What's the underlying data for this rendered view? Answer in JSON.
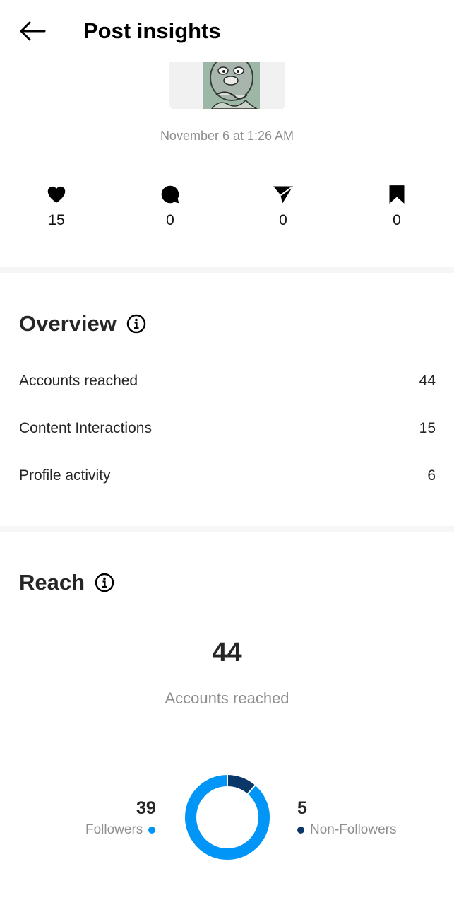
{
  "header": {
    "title": "Post insights"
  },
  "post": {
    "date": "November 6 at 1:26 AM"
  },
  "stats": [
    {
      "icon": "heart-icon",
      "value": "15"
    },
    {
      "icon": "comment-icon",
      "value": "0"
    },
    {
      "icon": "share-icon",
      "value": "0"
    },
    {
      "icon": "bookmark-icon",
      "value": "0"
    }
  ],
  "overview": {
    "title": "Overview",
    "rows": [
      {
        "label": "Accounts reached",
        "value": "44"
      },
      {
        "label": "Content Interactions",
        "value": "15"
      },
      {
        "label": "Profile activity",
        "value": "6"
      }
    ]
  },
  "reach": {
    "title": "Reach",
    "total": "44",
    "total_label": "Accounts reached",
    "followers": {
      "value": "39",
      "label": "Followers",
      "color": "#0095f6"
    },
    "non_followers": {
      "value": "5",
      "label": "Non-Followers",
      "color": "#0b3768"
    }
  },
  "chart_data": {
    "type": "pie",
    "categories": [
      "Followers",
      "Non-Followers"
    ],
    "values": [
      39,
      5
    ]
  }
}
